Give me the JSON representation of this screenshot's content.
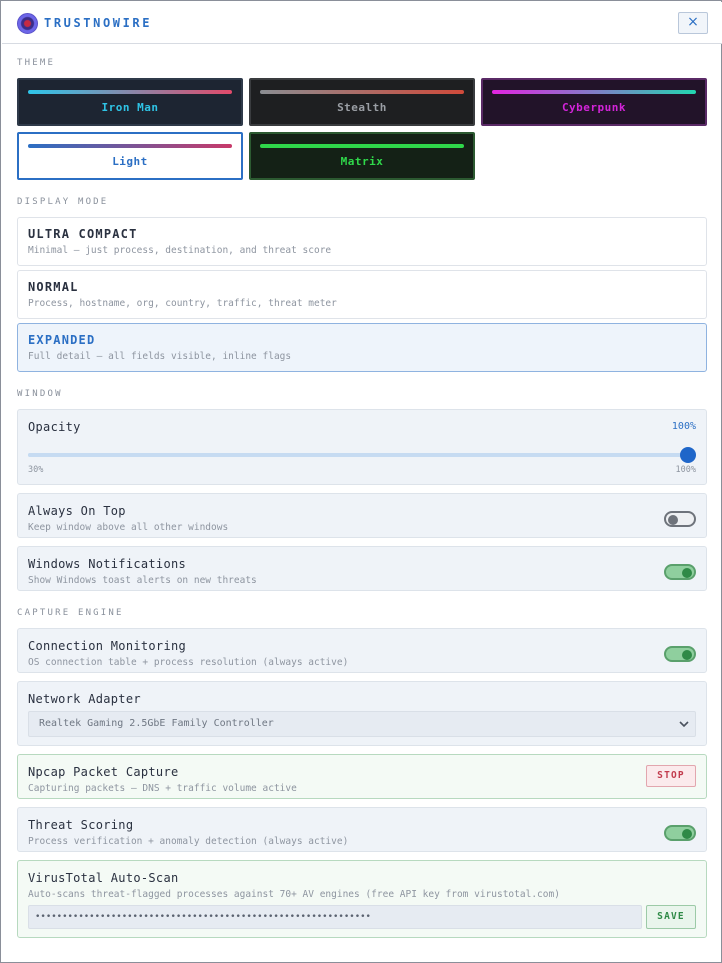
{
  "app": {
    "brand": "TRUSTNOWIRE",
    "close_glyph": "×"
  },
  "sections": {
    "theme": "THEME",
    "display_mode": "DISPLAY MODE",
    "window": "WINDOW",
    "capture_engine": "CAPTURE ENGINE"
  },
  "themes": [
    {
      "name": "Iron Man",
      "bg": "#1d2532",
      "border": "#2f3a4a",
      "text": "#2fc4e6",
      "bar_from": "#2ec6ea",
      "bar_to": "#e14a6a",
      "selected": false
    },
    {
      "name": "Stealth",
      "bg": "#1e1f21",
      "border": "#3a3c3f",
      "text": "#9a9ea4",
      "bar_from": "#8a8d92",
      "bar_to": "#d04a3a",
      "selected": false
    },
    {
      "name": "Cyberpunk",
      "bg": "#221329",
      "border": "#5a2a66",
      "text": "#d324d9",
      "bar_from": "#e224e0",
      "bar_to": "#22d6b0",
      "selected": false
    },
    {
      "name": "Light",
      "bg": "#ffffff",
      "border": "#2b6fc4",
      "text": "#2b6fc4",
      "bar_from": "#2b6fc4",
      "bar_to": "#c83a6a",
      "selected": true
    },
    {
      "name": "Matrix",
      "bg": "#142116",
      "border": "#2c5a31",
      "text": "#2fd84a",
      "bar_from": "#2fd84a",
      "bar_to": "#2fd84a",
      "selected": false
    }
  ],
  "display_modes": [
    {
      "title": "ULTRA COMPACT",
      "desc": "Minimal — just process, destination, and threat score",
      "active": false
    },
    {
      "title": "NORMAL",
      "desc": "Process, hostname, org, country, traffic, threat meter",
      "active": false
    },
    {
      "title": "EXPANDED",
      "desc": "Full detail — all fields visible, inline flags",
      "active": true
    }
  ],
  "window": {
    "opacity": {
      "label": "Opacity",
      "value_text": "100%",
      "min_label": "30%",
      "max_label": "100%",
      "value": 100,
      "min": 30,
      "max": 100
    },
    "always_on_top": {
      "title": "Always On Top",
      "desc": "Keep window above all other windows",
      "on": false
    },
    "notifications": {
      "title": "Windows Notifications",
      "desc": "Show Windows toast alerts on new threats",
      "on": true
    }
  },
  "capture": {
    "connection_monitoring": {
      "title": "Connection Monitoring",
      "desc": "OS connection table + process resolution (always active)",
      "on": true
    },
    "network_adapter": {
      "title": "Network Adapter",
      "selected": "Realtek Gaming 2.5GbE Family Controller"
    },
    "npcap": {
      "title": "Npcap Packet Capture",
      "desc": "Capturing packets — DNS + traffic volume active",
      "button": "STOP"
    },
    "threat_scoring": {
      "title": "Threat Scoring",
      "desc": "Process verification + anomaly detection (always active)",
      "on": true
    },
    "virustotal": {
      "title": "VirusTotal Auto-Scan",
      "desc": "Auto-scans threat-flagged processes against 70+ AV engines (free API key from virustotal.com)",
      "key_masked": "••••••••••••••••••••••••••••••••••••••••••••••••••••••••••••••",
      "button": "SAVE"
    }
  },
  "colors": {
    "accent": "#2b6fc4",
    "success": "#2f8a47",
    "danger": "#c23b4d"
  }
}
